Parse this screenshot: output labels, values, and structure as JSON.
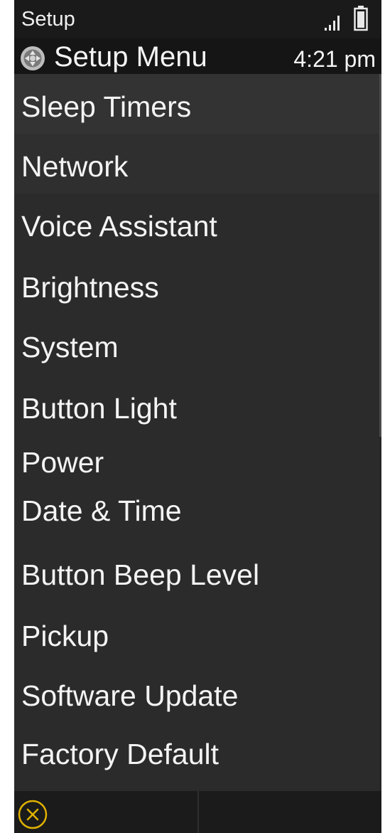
{
  "status_bar": {
    "title": "Setup",
    "icons": [
      "signal-icon",
      "battery-icon"
    ]
  },
  "header": {
    "icon": "menu-icon",
    "title": "Setup Menu",
    "time": "4:21 pm"
  },
  "menu": {
    "items": [
      {
        "label": "Sleep Timers"
      },
      {
        "label": "Network"
      },
      {
        "label": "Voice Assistant"
      },
      {
        "label": "Brightness"
      },
      {
        "label": "System"
      },
      {
        "label": "Button Light"
      },
      {
        "label": "Power"
      },
      {
        "label": "Date & Time"
      },
      {
        "label": "Button Beep Level"
      },
      {
        "label": "Pickup"
      },
      {
        "label": "Software Update"
      },
      {
        "label": "Factory Default"
      }
    ]
  },
  "bottom_bar": {
    "close_icon": "close-icon",
    "accent_color": "#e0b100"
  }
}
